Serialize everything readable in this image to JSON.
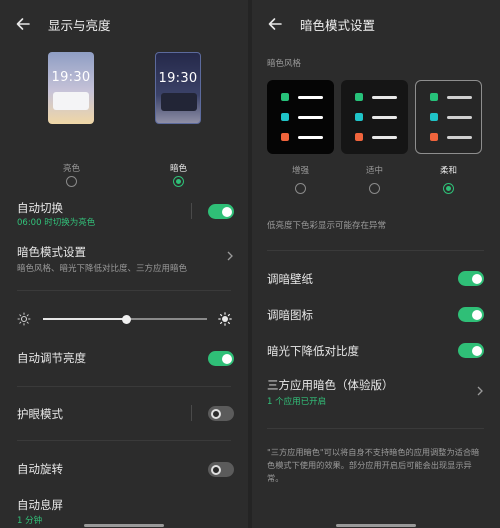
{
  "left": {
    "title": "显示与亮度",
    "light_label": "亮色",
    "dark_label": "暗色",
    "phone_time": "19:30",
    "auto_switch": {
      "title": "自动切换",
      "subtitle": "06:00 时切换为亮色"
    },
    "dark_settings": {
      "title": "暗色模式设置",
      "subtitle": "暗色风格、暗光下降低对比度、三方应用暗色"
    },
    "brightness_level": 0.51,
    "auto_brightness": "自动调节亮度",
    "eye_protection": "护眼模式",
    "auto_rotate": "自动旋转",
    "auto_lock": {
      "title": "自动息屏",
      "subtitle": "1 分钟"
    }
  },
  "right": {
    "title": "暗色模式设置",
    "section_label": "暗色风格",
    "styles": [
      "增强",
      "适中",
      "柔和"
    ],
    "selected_style": "柔和",
    "notice": "低亮度下色彩显示可能存在异常",
    "dim_wallpaper": "调暗壁纸",
    "dim_icons": "调暗图标",
    "low_contrast": "暗光下降低对比度",
    "third_party": {
      "title": "三方应用暗色（体验版）",
      "subtitle": "1 个应用已开启"
    },
    "footnote_line1": "\"三方应用暗色\"可以将自身不支持暗色的应用调整为适合暗",
    "footnote_line2": "色模式下使用的效果。部分应用开启后可能会出现显示异",
    "footnote_line3": "常。"
  },
  "colors": {
    "accent": "#2fbf77",
    "dot_green": "#27c27a",
    "dot_teal": "#1fc4c8",
    "dot_orange": "#f0643c"
  }
}
